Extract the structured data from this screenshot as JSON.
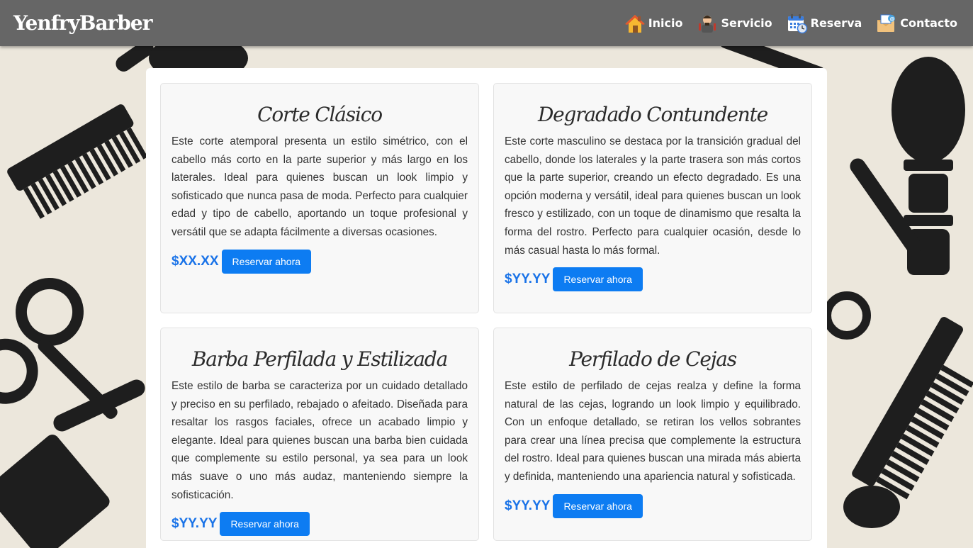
{
  "navbar": {
    "brand": "YenfryBarber",
    "items": [
      {
        "label": "Inicio",
        "icon": "house-icon"
      },
      {
        "label": "Servicio",
        "icon": "barber-icon"
      },
      {
        "label": "Reserva",
        "icon": "calendar-icon"
      },
      {
        "label": "Contacto",
        "icon": "mail-icon"
      }
    ]
  },
  "services": [
    {
      "title": "Corte Clásico",
      "description": "Este corte atemporal presenta un estilo simétrico, con el cabello más corto en la parte superior y más largo en los laterales. Ideal para quienes buscan un look limpio y sofisticado que nunca pasa de moda. Perfecto para cualquier edad y tipo de cabello, aportando un toque profesional y versátil que se adapta fácilmente a diversas ocasiones.",
      "price": "$XX.XX",
      "button": "Reservar ahora"
    },
    {
      "title": "Degradado Contundente",
      "description": "Este corte masculino se destaca por la transición gradual del cabello, donde los laterales y la parte trasera son más cortos que la parte superior, creando un efecto degradado. Es una opción moderna y versátil, ideal para quienes buscan un look fresco y estilizado, con un toque de dinamismo que resalta la forma del rostro. Perfecto para cualquier ocasión, desde lo más casual hasta lo más formal.",
      "price": "$YY.YY",
      "button": "Reservar ahora"
    },
    {
      "title": "Barba Perfilada y Estilizada",
      "description": "Este estilo de barba se caracteriza por un cuidado detallado y preciso en su perfilado, rebajado o afeitado. Diseñada para resaltar los rasgos faciales, ofrece un acabado limpio y elegante. Ideal para quienes buscan una barba bien cuidada que complemente su estilo personal, ya sea para un look más suave o uno más audaz, manteniendo siempre la sofisticación.",
      "price": "$YY.YY",
      "button": "Reservar ahora"
    },
    {
      "title": "Perfilado de Cejas",
      "description": "Este estilo de perfilado de cejas realza y define la forma natural de las cejas, logrando un look limpio y equilibrado. Con un enfoque detallado, se retiran los vellos sobrantes para crear una línea precisa que complemente la estructura del rostro. Ideal para quienes buscan una mirada más abierta y definida, manteniendo una apariencia natural y sofisticada.",
      "price": "$YY.YY",
      "button": "Reservar ahora"
    }
  ],
  "colors": {
    "navbar": "#666666",
    "accent": "#0d7cf2",
    "price": "#1a73e8",
    "background": "#ece7dc",
    "pattern": "#1e1e1e"
  }
}
